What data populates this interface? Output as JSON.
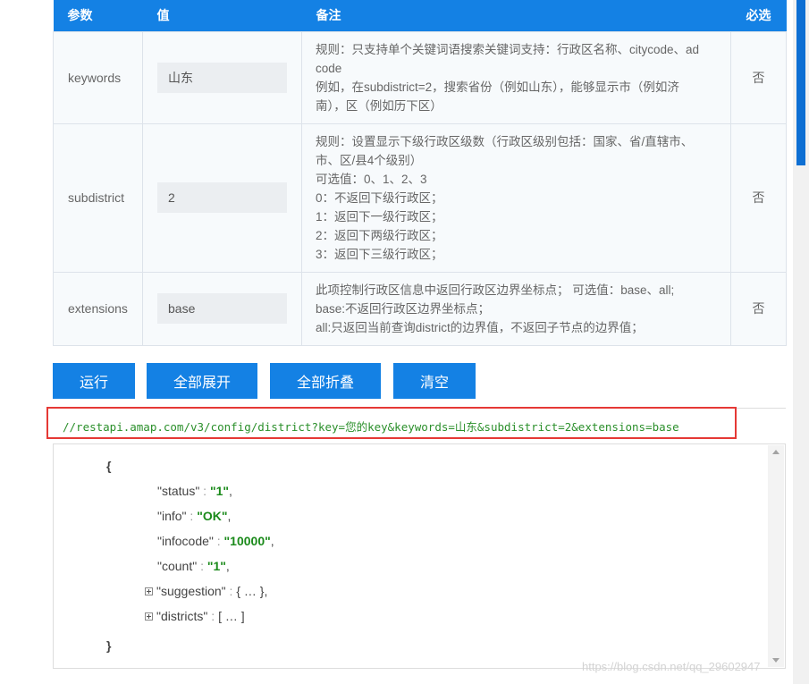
{
  "table": {
    "headers": {
      "param": "参数",
      "value": "值",
      "remark": "备注",
      "required": "必选"
    },
    "rows": [
      {
        "name": "keywords",
        "value": "山东",
        "remark": [
          "规则：只支持单个关键词语搜索关键词支持：行政区名称、citycode、ad",
          "code",
          "例如，在subdistrict=2，搜索省份（例如山东），能够显示市（例如济",
          "南），区（例如历下区）"
        ],
        "required": "否"
      },
      {
        "name": "subdistrict",
        "value": "2",
        "remark": [
          "规则：设置显示下级行政区级数（行政区级别包括：国家、省/直辖市、",
          "市、区/县4个级别）",
          "可选值：0、1、2、3",
          "0：不返回下级行政区；",
          "1：返回下一级行政区；",
          "2：返回下两级行政区；",
          "3：返回下三级行政区；"
        ],
        "required": "否"
      },
      {
        "name": "extensions",
        "value": "base",
        "remark": [
          "此项控制行政区信息中返回行政区边界坐标点； 可选值：base、all;",
          "base:不返回行政区边界坐标点；",
          "all:只返回当前查询district的边界值，不返回子节点的边界值；"
        ],
        "required": "否"
      }
    ]
  },
  "buttons": {
    "run": "运行",
    "expand_all": "全部展开",
    "collapse_all": "全部折叠",
    "clear": "清空"
  },
  "request_url": "//restapi.amap.com/v3/config/district?key=您的key&keywords=山东&subdistrict=2&extensions=base",
  "json_view": {
    "open_brace": "{",
    "close_brace": "}",
    "status": {
      "key": "\"status\"",
      "value": "\"1\""
    },
    "info": {
      "key": "\"info\"",
      "value": "\"OK\""
    },
    "infocode": {
      "key": "\"infocode\"",
      "value": "\"10000\""
    },
    "count": {
      "key": "\"count\"",
      "value": "\"1\""
    },
    "suggestion": {
      "key": "\"suggestion\"",
      "value": "{ … }"
    },
    "districts": {
      "key": "\"districts\"",
      "value": "[ … ]"
    },
    "colon": " : ",
    "comma": ","
  },
  "watermark": "https://blog.csdn.net/qq_29602947"
}
